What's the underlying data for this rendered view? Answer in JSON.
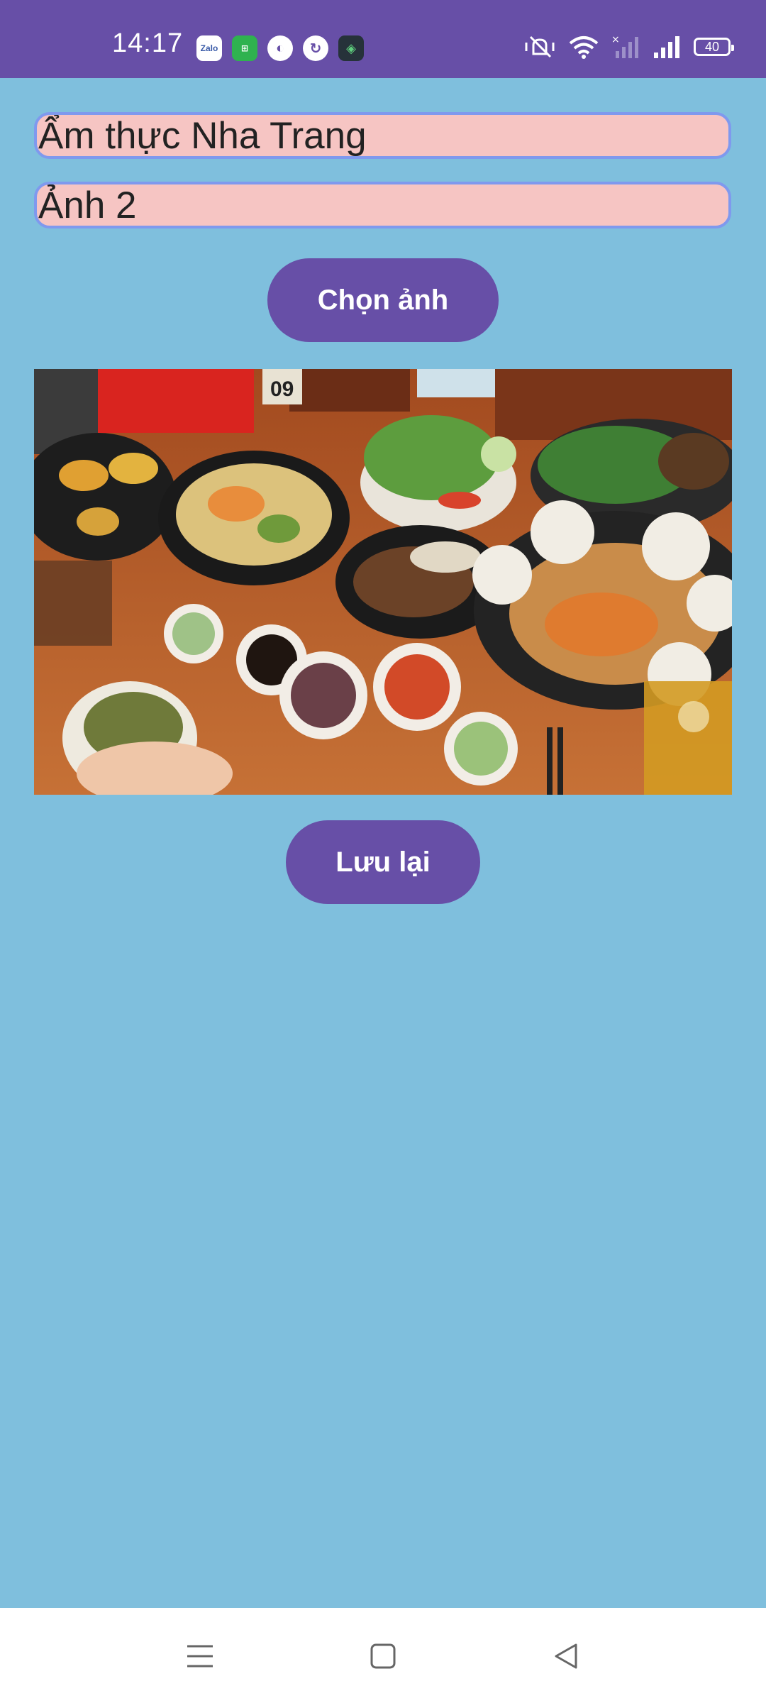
{
  "status_bar": {
    "time": "14:17",
    "notification_icons": [
      "zalo-icon",
      "shopee-icon",
      "app-icon",
      "circle-app-icon",
      "security-icon"
    ],
    "zalo_label": "Zalo",
    "battery": "40",
    "system_icons": [
      "vibrate-icon",
      "wifi-icon",
      "no-signal-icon",
      "signal-icon",
      "battery-icon"
    ]
  },
  "form": {
    "title_value": "Ẩm thực Nha Trang",
    "name_value": "Ảnh 2",
    "choose_button": "Chọn ảnh",
    "save_button": "Lưu lại"
  },
  "photo": {
    "table_number": "09",
    "description_hidden": ""
  },
  "navigation": {
    "icons": [
      "menu-icon",
      "home-icon",
      "back-icon"
    ]
  },
  "colors": {
    "status_bar": "#674fa7",
    "background": "#7fbfdd",
    "input_bg": "#f6c5c3",
    "input_border": "#7f99ee",
    "button": "#674fa7"
  }
}
